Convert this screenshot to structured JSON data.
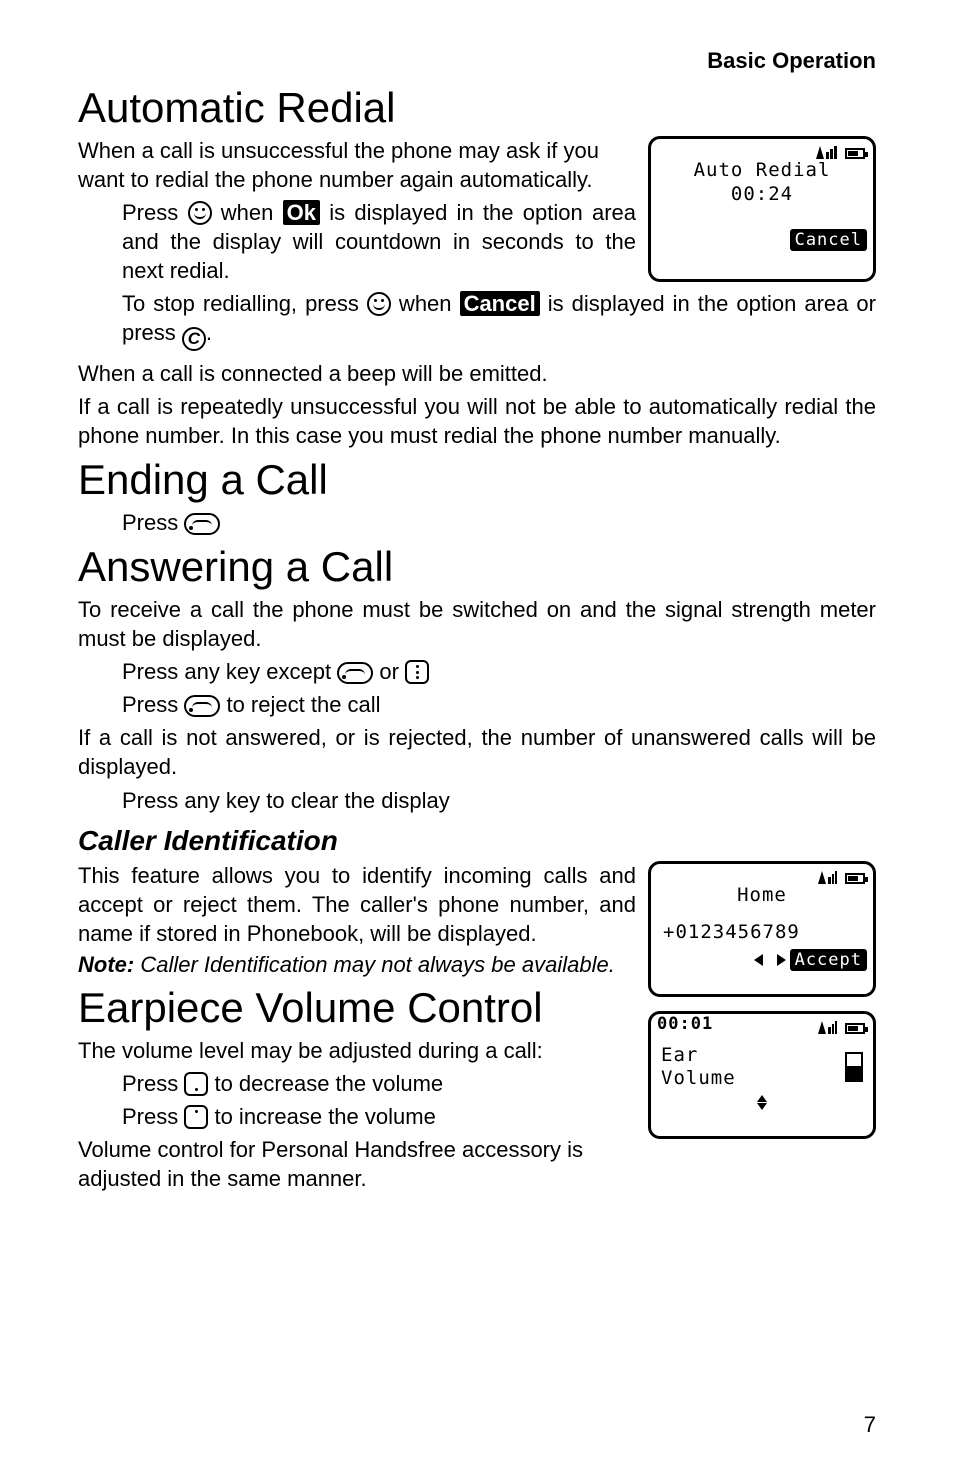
{
  "header": {
    "section": "Basic Operation"
  },
  "page_number": "7",
  "sections": {
    "auto_redial": {
      "title": "Automatic Redial",
      "p1": "When a call is unsuccessful the phone may ask if you want to redial the phone number again automatically.",
      "i1_a": "Press ",
      "i1_b": " when ",
      "i1_label": "Ok",
      "i1_c": " is displayed in the option area and the display will countdown in seconds to the next redial.",
      "i2_a": "To stop redialling, press ",
      "i2_b": " when ",
      "i2_label": "Cancel",
      "i2_c": " is displayed in the option area or press ",
      "i2_d": ".",
      "p2": "When a call is connected a beep will be emitted.",
      "p3": "If a call is repeatedly unsuccessful you will not be able to automatically redial the phone number. In this case you must redial the phone number manually."
    },
    "ending": {
      "title": "Ending a Call",
      "i1": "Press "
    },
    "answering": {
      "title": "Answering a Call",
      "p1": "To receive a call the phone must be switched on and the signal strength meter must be displayed.",
      "i1_a": "Press any key except ",
      "i1_b": " or ",
      "i2_a": "Press ",
      "i2_b": " to reject the call",
      "p2": "If a call is not answered, or is rejected, the number of unanswered calls will be displayed.",
      "i3": "Press any key to clear the display"
    },
    "caller_id": {
      "title": "Caller Identification",
      "p1": "This feature allows you to identify incoming calls and accept or reject them. The caller's phone number, and name if stored in Phonebook, will be displayed.",
      "note_label": "Note:",
      "note_text": " Caller Identification may not always be available."
    },
    "earpiece": {
      "title": "Earpiece Volume Control",
      "p1": "The volume level may be adjusted during a call:",
      "i1_a": "Press ",
      "i1_b": " to decrease the volume",
      "i2_a": "Press ",
      "i2_b": " to increase the volume",
      "p2": "Volume control for Personal Handsfree accessory is adjusted in the same manner."
    }
  },
  "screens": {
    "fig1": {
      "l1": "Auto Redial",
      "l2": "00:24",
      "opt": "Cancel"
    },
    "fig2": {
      "l1": "Home",
      "l2": "+0123456789",
      "opt": "Accept"
    },
    "fig3": {
      "clock": "00:01",
      "l1": "Ear",
      "l2": "Volume"
    }
  }
}
